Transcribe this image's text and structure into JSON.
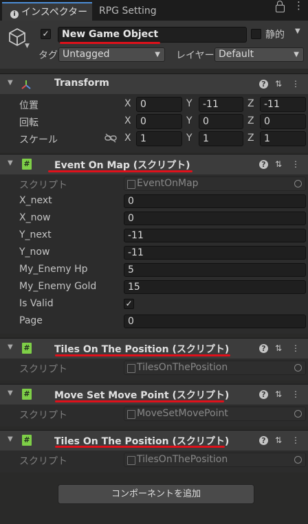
{
  "tabs": {
    "active": "インスペクター",
    "other": "RPG Setting"
  },
  "object": {
    "name": "New Game Object",
    "static_label": "静的",
    "tag_label": "タグ",
    "tag_value": "Untagged",
    "layer_label": "レイヤー",
    "layer_value": "Default"
  },
  "transform": {
    "title": "Transform",
    "position": {
      "label": "位置",
      "x": "0",
      "y": "-11",
      "z": "-11"
    },
    "rotation": {
      "label": "回転",
      "x": "0",
      "y": "0",
      "z": "0"
    },
    "scale": {
      "label": "スケール",
      "x": "1",
      "y": "1",
      "z": "1"
    },
    "axis": {
      "x": "X",
      "y": "Y",
      "z": "Z"
    }
  },
  "event_on_map": {
    "title": "Event On Map (スクリプト)",
    "script_label": "スクリプト",
    "script_value": "EventOnMap",
    "fields": [
      {
        "label": "X_next",
        "value": "0"
      },
      {
        "label": "X_now",
        "value": "0"
      },
      {
        "label": "Y_next",
        "value": "-11"
      },
      {
        "label": "Y_now",
        "value": "-11"
      },
      {
        "label": "My_Enemy Hp",
        "value": "5"
      },
      {
        "label": "My_Enemy Gold",
        "value": "15"
      }
    ],
    "is_valid_label": "Is Valid",
    "page_label": "Page",
    "page_value": "0"
  },
  "tiles1": {
    "title": "Tiles On The Position (スクリプト)",
    "script_label": "スクリプト",
    "script_value": "TilesOnThePosition"
  },
  "moveset": {
    "title": "Move Set Move Point (スクリプト)",
    "script_label": "スクリプト",
    "script_value": "MoveSetMovePoint"
  },
  "tiles2": {
    "title": "Tiles On The Position (スクリプト)",
    "script_label": "スクリプト",
    "script_value": "TilesOnThePosition"
  },
  "add_component": "コンポーネントを追加",
  "colors": {
    "accent_underline": "#e0101a",
    "script_icon": "#7ecf47",
    "tab_highlight": "#4d8ed8"
  }
}
